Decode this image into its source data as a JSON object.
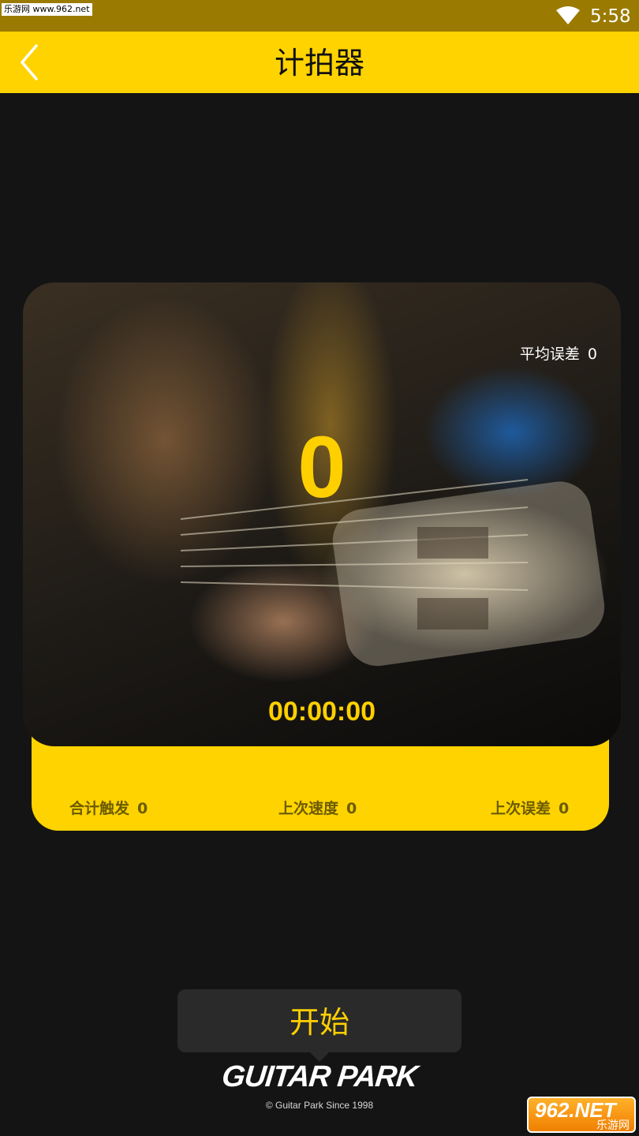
{
  "status_bar": {
    "watermark": "乐游网 www.962.net",
    "time": "5:58",
    "wifi_icon": "wifi-icon"
  },
  "header": {
    "back_icon": "chevron-left-icon",
    "title": "计拍器"
  },
  "card": {
    "avg_error_label": "平均误差",
    "avg_error_value": "0",
    "beat_count": "0",
    "timer": "00:00:00"
  },
  "stats": [
    {
      "label": "合计触发",
      "value": "0"
    },
    {
      "label": "上次速度",
      "value": "0"
    },
    {
      "label": "上次误差",
      "value": "0"
    }
  ],
  "start_button": {
    "label": "开始"
  },
  "footer": {
    "brand": "GUITAR PARK",
    "copyright": "© Guitar Park  Since 1998"
  },
  "watermark_br": {
    "logo": "962.NET",
    "text": "乐游网"
  },
  "colors": {
    "accent": "#ffd300",
    "status_bar": "#9a7a00",
    "background": "#141414",
    "beat_text": "#ffd000"
  }
}
